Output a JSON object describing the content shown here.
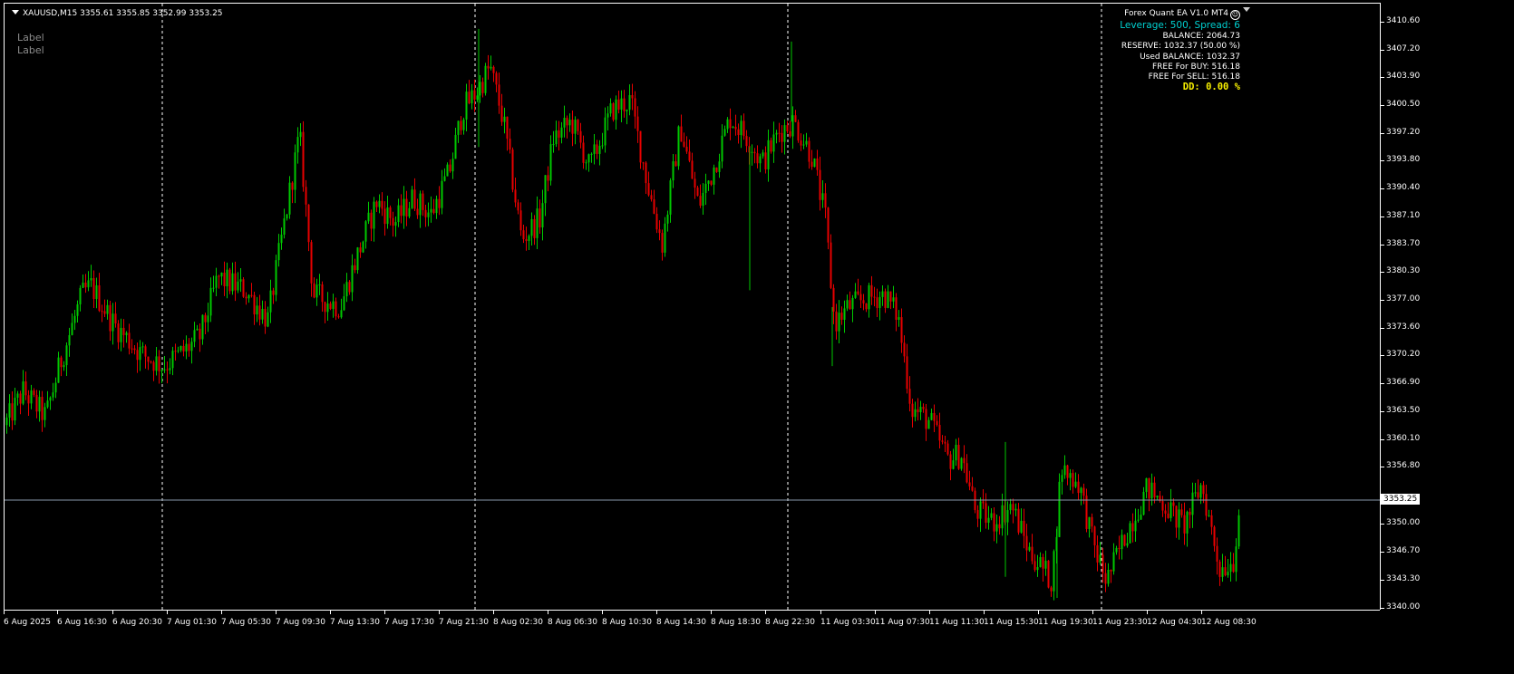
{
  "symbol_info": "XAUUSD,M15  3355.61 3355.85 3352.99 3353.25",
  "labels": [
    "Label",
    "Label"
  ],
  "ea_panel": {
    "title": "Forex Quant EA V1.0 MT4",
    "smile_icon": "smile-icon",
    "leverage": "Leverage: 500, Spread: 6",
    "balance": "BALANCE: 2064.73",
    "reserve": "RESERVE: 1032.37 (50.00 %)",
    "used_balance": "Used BALANCE: 1032.37",
    "free_buy": "FREE For BUY: 516.18",
    "free_sell": "FREE For SELL: 516.18",
    "dd": "DD:  0.00 %",
    "colors": {
      "leverage": "#00d0d0",
      "dd": "#f7f000"
    }
  },
  "current_price": "3353.25",
  "price_axis": [
    "3410.60",
    "3407.20",
    "3403.90",
    "3400.50",
    "3397.20",
    "3393.80",
    "3390.40",
    "3387.10",
    "3383.70",
    "3380.30",
    "3377.00",
    "3373.60",
    "3370.20",
    "3366.90",
    "3363.50",
    "3360.10",
    "3356.80",
    "3353.25",
    "3350.00",
    "3346.70",
    "3343.30",
    "3340.00"
  ],
  "time_axis": [
    "6 Aug 2025",
    "6 Aug 16:30",
    "6 Aug 20:30",
    "7 Aug 01:30",
    "7 Aug 05:30",
    "7 Aug 09:30",
    "7 Aug 13:30",
    "7 Aug 17:30",
    "7 Aug 21:30",
    "8 Aug 02:30",
    "8 Aug 06:30",
    "8 Aug 10:30",
    "8 Aug 14:30",
    "8 Aug 18:30",
    "8 Aug 22:30",
    "11 Aug 03:30",
    "11 Aug 07:30",
    "11 Aug 11:30",
    "11 Aug 15:30",
    "11 Aug 19:30",
    "11 Aug 23:30",
    "12 Aug 04:30",
    "12 Aug 08:30"
  ],
  "chart_data": {
    "type": "candlestick",
    "symbol": "XAUUSD",
    "timeframe": "M15",
    "ylim": [
      3340.0,
      3412.0
    ],
    "colors": {
      "bull": "#00c800",
      "bear": "#e60000",
      "grid_period": "#ffffff",
      "price_line": "#8899aa"
    },
    "period_separators_after_label": [
      "6 Aug 20:30",
      "7 Aug 21:30",
      "8 Aug 22:30",
      "11 Aug 23:30"
    ],
    "close_path": [
      [
        0,
        3362.0
      ],
      [
        20,
        3366.0
      ],
      [
        45,
        3363.0
      ],
      [
        60,
        3369.0
      ],
      [
        85,
        3377.5
      ],
      [
        95,
        3378.5
      ],
      [
        120,
        3374.0
      ],
      [
        150,
        3370.5
      ],
      [
        175,
        3369.0
      ],
      [
        200,
        3371.0
      ],
      [
        215,
        3372.5
      ],
      [
        235,
        3379.5
      ],
      [
        265,
        3378.0
      ],
      [
        290,
        3374.5
      ],
      [
        305,
        3384.0
      ],
      [
        325,
        3396.5
      ],
      [
        340,
        3377.5
      ],
      [
        370,
        3376.0
      ],
      [
        385,
        3381.0
      ],
      [
        410,
        3388.5
      ],
      [
        430,
        3386.0
      ],
      [
        450,
        3389.0
      ],
      [
        470,
        3387.0
      ],
      [
        490,
        3392.0
      ],
      [
        505,
        3399.5
      ],
      [
        520,
        3401.5
      ],
      [
        535,
        3404.5
      ],
      [
        550,
        3398.0
      ],
      [
        570,
        3384.0
      ],
      [
        590,
        3386.5
      ],
      [
        605,
        3396.0
      ],
      [
        625,
        3398.0
      ],
      [
        645,
        3392.5
      ],
      [
        670,
        3399.5
      ],
      [
        690,
        3400.5
      ],
      [
        710,
        3390.0
      ],
      [
        725,
        3383.5
      ],
      [
        745,
        3397.5
      ],
      [
        765,
        3388.0
      ],
      [
        780,
        3392.0
      ],
      [
        800,
        3398.5
      ],
      [
        820,
        3396.0
      ],
      [
        835,
        3393.0
      ],
      [
        855,
        3397.0
      ],
      [
        870,
        3398.0
      ],
      [
        890,
        3394.0
      ],
      [
        905,
        3386.5
      ],
      [
        915,
        3374.0
      ],
      [
        930,
        3376.0
      ],
      [
        950,
        3377.0
      ],
      [
        970,
        3377.5
      ],
      [
        985,
        3375.0
      ],
      [
        1000,
        3364.0
      ],
      [
        1020,
        3362.5
      ],
      [
        1040,
        3358.0
      ],
      [
        1055,
        3358.5
      ],
      [
        1070,
        3352.0
      ],
      [
        1090,
        3350.5
      ],
      [
        1110,
        3352.5
      ],
      [
        1130,
        3347.0
      ],
      [
        1155,
        3343.5
      ],
      [
        1165,
        3357.0
      ],
      [
        1185,
        3355.0
      ],
      [
        1200,
        3348.0
      ],
      [
        1215,
        3343.5
      ],
      [
        1240,
        3350.0
      ],
      [
        1260,
        3354.5
      ],
      [
        1280,
        3352.5
      ],
      [
        1300,
        3350.0
      ],
      [
        1320,
        3355.0
      ],
      [
        1340,
        3345.0
      ],
      [
        1355,
        3346.0
      ],
      [
        1365,
        3355.5
      ]
    ]
  }
}
